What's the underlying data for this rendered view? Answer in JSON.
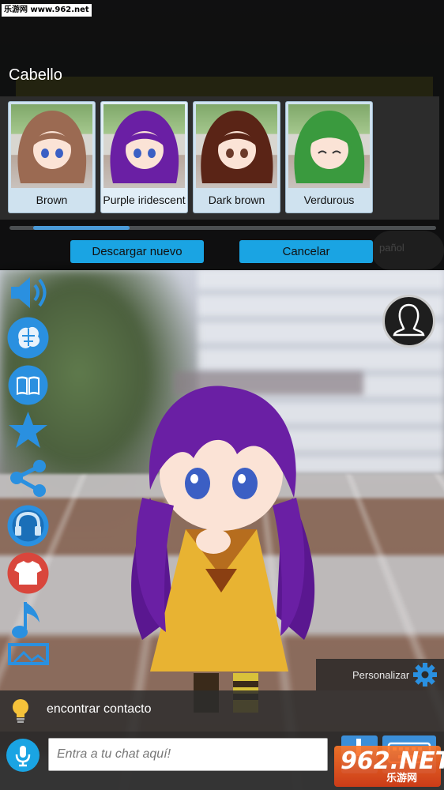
{
  "watermark_top": "乐游网 www.962.net",
  "hair_panel": {
    "title": "Cabello",
    "options": [
      {
        "label": "Brown",
        "color": "#9b6a52"
      },
      {
        "label": "Purple iridescent",
        "color": "#6a1fa4"
      },
      {
        "label": "Dark brown",
        "color": "#5a2416"
      },
      {
        "label": "Verdurous",
        "color": "#3a9a3e"
      }
    ],
    "download_label": "Descargar nuevo",
    "cancel_label": "Cancelar",
    "scroll_position": 0.05
  },
  "background_label": "pañol",
  "side_menu": [
    {
      "icon": "speaker-icon"
    },
    {
      "icon": "brain-icon"
    },
    {
      "icon": "book-icon"
    },
    {
      "icon": "star-icon"
    },
    {
      "icon": "share-icon"
    },
    {
      "icon": "headset-icon"
    },
    {
      "icon": "tshirt-icon"
    },
    {
      "icon": "music-note-icon"
    },
    {
      "icon": "image-frame-icon"
    }
  ],
  "profile_icon": "person-outline-icon",
  "personalize_label": "Personalizar",
  "suggestion_text": "encontrar contacto",
  "chat": {
    "placeholder": "Entra a tu chat aquí!"
  },
  "watermark_bottom": {
    "main": "962.NET",
    "sub": "乐游网"
  },
  "colors": {
    "accent": "#1aa4e3",
    "button_blue": "#3b8fd9",
    "character_hair": "#6a1fa4",
    "dress": "#e8b332"
  }
}
